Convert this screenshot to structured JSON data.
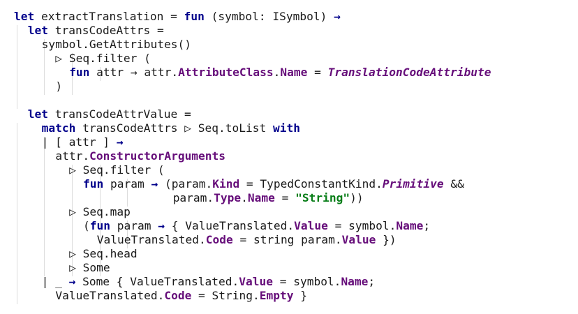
{
  "editor": {
    "lines": [
      {
        "indent": 0,
        "tokens": [
          {
            "t": "let",
            "c": "kw"
          },
          {
            "t": " extractTranslation = "
          },
          {
            "t": "fun",
            "c": "kw"
          },
          {
            "t": " (symbol: ISymbol) "
          },
          {
            "t": "→",
            "c": "kw"
          }
        ]
      },
      {
        "indent": 2,
        "tokens": [
          {
            "t": "let",
            "c": "kw"
          },
          {
            "t": " transCodeAttrs ="
          }
        ]
      },
      {
        "indent": 4,
        "tokens": [
          {
            "t": "symbol.GetAttributes()"
          }
        ]
      },
      {
        "indent": 6,
        "tokens": [
          {
            "t": "▷ Seq.filter ("
          }
        ]
      },
      {
        "indent": 8,
        "tokens": [
          {
            "t": "fun",
            "c": "kw"
          },
          {
            "t": " attr → attr."
          },
          {
            "t": "AttributeClass",
            "c": "mem"
          },
          {
            "t": "."
          },
          {
            "t": "Name",
            "c": "mem"
          },
          {
            "t": " = "
          },
          {
            "t": "TranslationCodeAttribute",
            "c": "it"
          }
        ]
      },
      {
        "indent": 6,
        "tokens": [
          {
            "t": ")"
          }
        ]
      },
      {
        "indent": 0,
        "tokens": []
      },
      {
        "indent": 2,
        "tokens": [
          {
            "t": "let",
            "c": "kw"
          },
          {
            "t": " transCodeAttrValue ="
          }
        ]
      },
      {
        "indent": 4,
        "tokens": [
          {
            "t": "match",
            "c": "kw"
          },
          {
            "t": " transCodeAttrs ▷ Seq.toList "
          },
          {
            "t": "with",
            "c": "kw"
          }
        ]
      },
      {
        "indent": 4,
        "tokens": [
          {
            "t": "| [ attr ] "
          },
          {
            "t": "→",
            "c": "kw"
          }
        ]
      },
      {
        "indent": 6,
        "tokens": [
          {
            "t": "attr."
          },
          {
            "t": "ConstructorArguments",
            "c": "mem"
          }
        ]
      },
      {
        "indent": 8,
        "tokens": [
          {
            "t": "▷ Seq.filter ("
          }
        ]
      },
      {
        "indent": 10,
        "tokens": [
          {
            "t": "fun",
            "c": "kw"
          },
          {
            "t": " param "
          },
          {
            "t": "→",
            "c": "kw"
          },
          {
            "t": " (param."
          },
          {
            "t": "Kind",
            "c": "mem"
          },
          {
            "t": " = TypedConstantKind."
          },
          {
            "t": "Primitive",
            "c": "it"
          },
          {
            "t": " &&"
          }
        ]
      },
      {
        "indent": 23,
        "tokens": [
          {
            "t": "param."
          },
          {
            "t": "Type",
            "c": "mem"
          },
          {
            "t": "."
          },
          {
            "t": "Name",
            "c": "mem"
          },
          {
            "t": " = "
          },
          {
            "t": "\"String\"",
            "c": "str"
          },
          {
            "t": "))"
          }
        ]
      },
      {
        "indent": 8,
        "tokens": [
          {
            "t": "▷ Seq.map"
          }
        ]
      },
      {
        "indent": 10,
        "tokens": [
          {
            "t": "("
          },
          {
            "t": "fun",
            "c": "kw"
          },
          {
            "t": " param "
          },
          {
            "t": "→",
            "c": "kw"
          },
          {
            "t": " { ValueTranslated."
          },
          {
            "t": "Value",
            "c": "mem"
          },
          {
            "t": " = symbol."
          },
          {
            "t": "Name",
            "c": "mem"
          },
          {
            "t": ";"
          }
        ]
      },
      {
        "indent": 12,
        "tokens": [
          {
            "t": "ValueTranslated."
          },
          {
            "t": "Code",
            "c": "mem"
          },
          {
            "t": " = string param."
          },
          {
            "t": "Value",
            "c": "mem"
          },
          {
            "t": " })"
          }
        ]
      },
      {
        "indent": 8,
        "tokens": [
          {
            "t": "▷ Seq.head"
          }
        ]
      },
      {
        "indent": 8,
        "tokens": [
          {
            "t": "▷ Some"
          }
        ]
      },
      {
        "indent": 4,
        "tokens": [
          {
            "t": "| _ "
          },
          {
            "t": "→",
            "c": "kw"
          },
          {
            "t": " Some { ValueTranslated."
          },
          {
            "t": "Value",
            "c": "mem"
          },
          {
            "t": " = symbol."
          },
          {
            "t": "Name",
            "c": "mem"
          },
          {
            "t": ";"
          }
        ]
      },
      {
        "indent": 6,
        "tokens": [
          {
            "t": "ValueTranslated."
          },
          {
            "t": "Code",
            "c": "mem"
          },
          {
            "t": " = String."
          },
          {
            "t": "Empty",
            "c": "mem"
          },
          {
            "t": " }"
          }
        ]
      }
    ]
  }
}
